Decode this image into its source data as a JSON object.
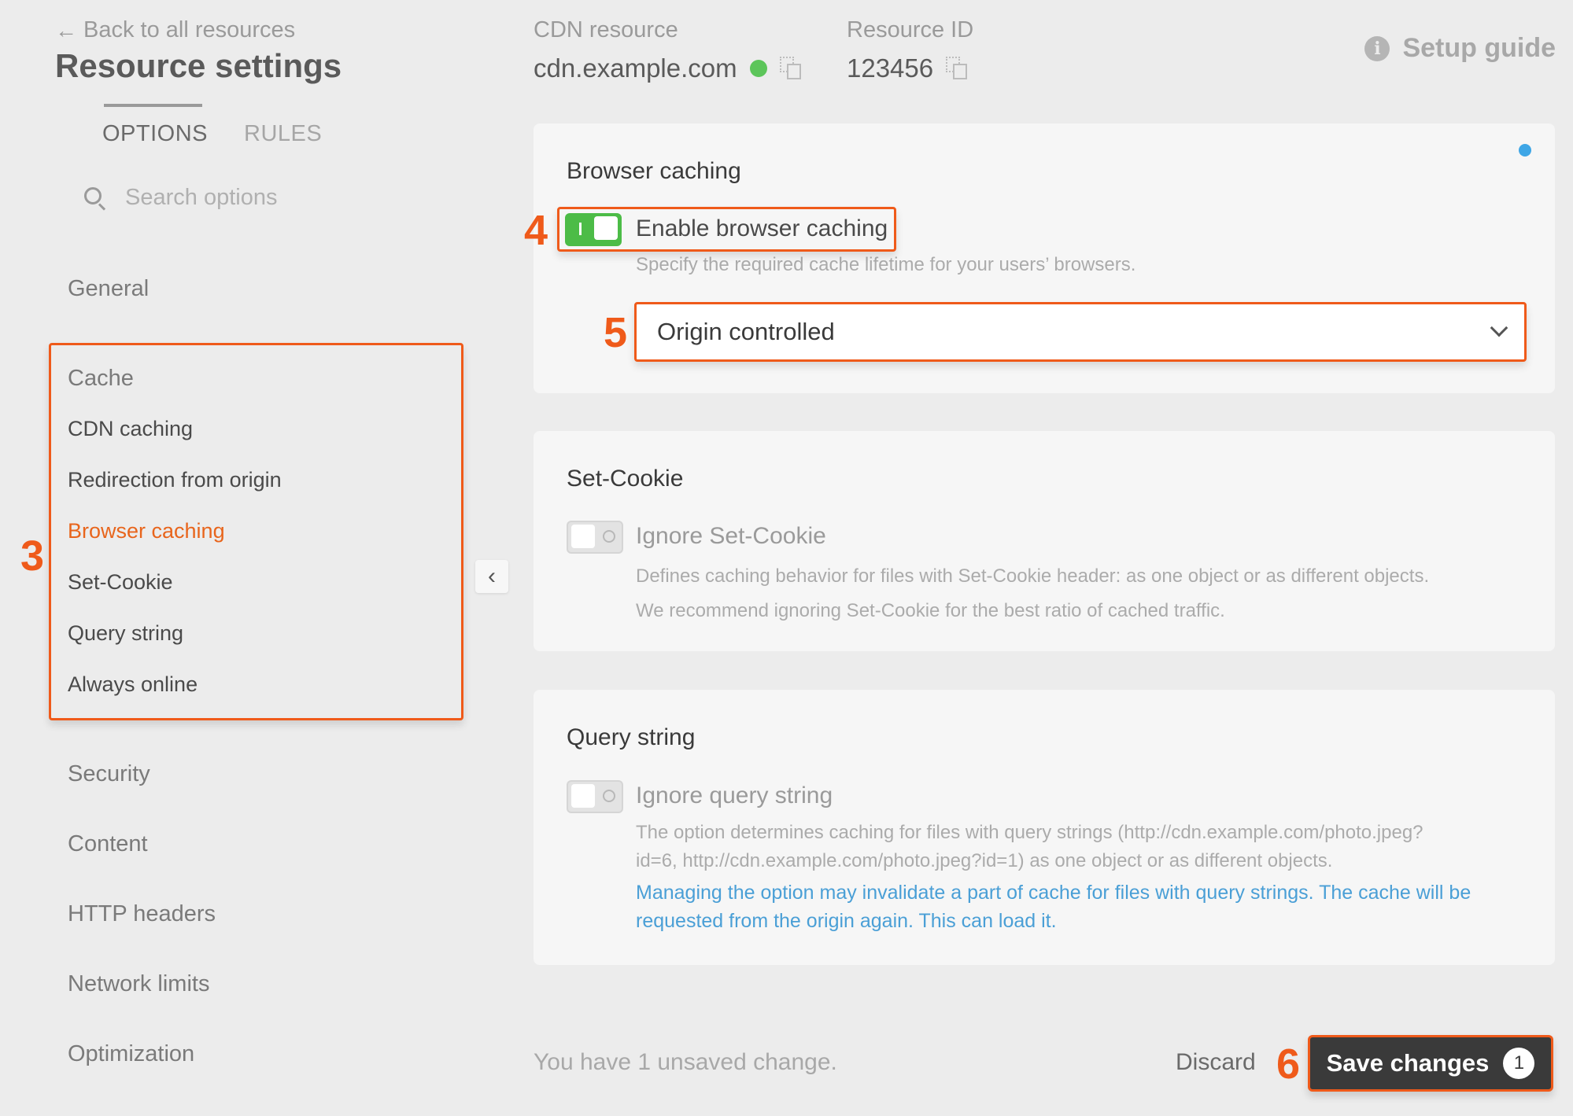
{
  "header": {
    "back_link": "Back to all resources",
    "title": "Resource settings",
    "cdn_label": "CDN resource",
    "cdn_value": "cdn.example.com",
    "resource_id_label": "Resource ID",
    "resource_id_value": "123456",
    "setup_guide": "Setup guide",
    "status_color": "#5cc55a"
  },
  "tabs": [
    {
      "label": "OPTIONS",
      "active": true
    },
    {
      "label": "RULES",
      "active": false
    }
  ],
  "search": {
    "placeholder": "Search options"
  },
  "sidebar": {
    "general": "General",
    "cache_group": {
      "title": "Cache",
      "items": [
        "CDN caching",
        "Redirection from origin",
        "Browser caching",
        "Set-Cookie",
        "Query string",
        "Always online"
      ],
      "active": "Browser caching"
    },
    "sections": [
      "Security",
      "Content",
      "HTTP headers",
      "Network limits",
      "Optimization"
    ]
  },
  "callouts": [
    "3",
    "4",
    "5",
    "6"
  ],
  "cards": {
    "browser_caching": {
      "title": "Browser caching",
      "toggle_label": "Enable browser caching",
      "toggle_on": true,
      "description": "Specify the required cache lifetime for your users’ browsers.",
      "select_value": "Origin controlled"
    },
    "set_cookie": {
      "title": "Set-Cookie",
      "toggle_label": "Ignore Set-Cookie",
      "toggle_on": false,
      "description_1": "Defines caching behavior for files with Set-Cookie header: as one object or as different objects.",
      "description_2": "We recommend ignoring Set-Cookie for the best ratio of cached traffic."
    },
    "query_string": {
      "title": "Query string",
      "toggle_label": "Ignore query string",
      "toggle_on": false,
      "description_1": "The option determines caching for files with query strings (http://cdn.example.com/photo.jpeg?",
      "description_2": "id=6, http://cdn.example.com/photo.jpeg?id=1) as one object or as different objects.",
      "warning_1": "Managing the option may invalidate a part of cache for files with query strings. The cache will be",
      "warning_2": "requested from the origin again. This can load it."
    }
  },
  "footer": {
    "unsaved_text": "You have 1 unsaved change.",
    "discard": "Discard",
    "save": "Save changes",
    "save_count": "1"
  },
  "colors": {
    "accent": "#ef5a1a",
    "toggle_on": "#4cbc47",
    "link": "#4a9fd6",
    "active_nav": "#e8651c"
  }
}
